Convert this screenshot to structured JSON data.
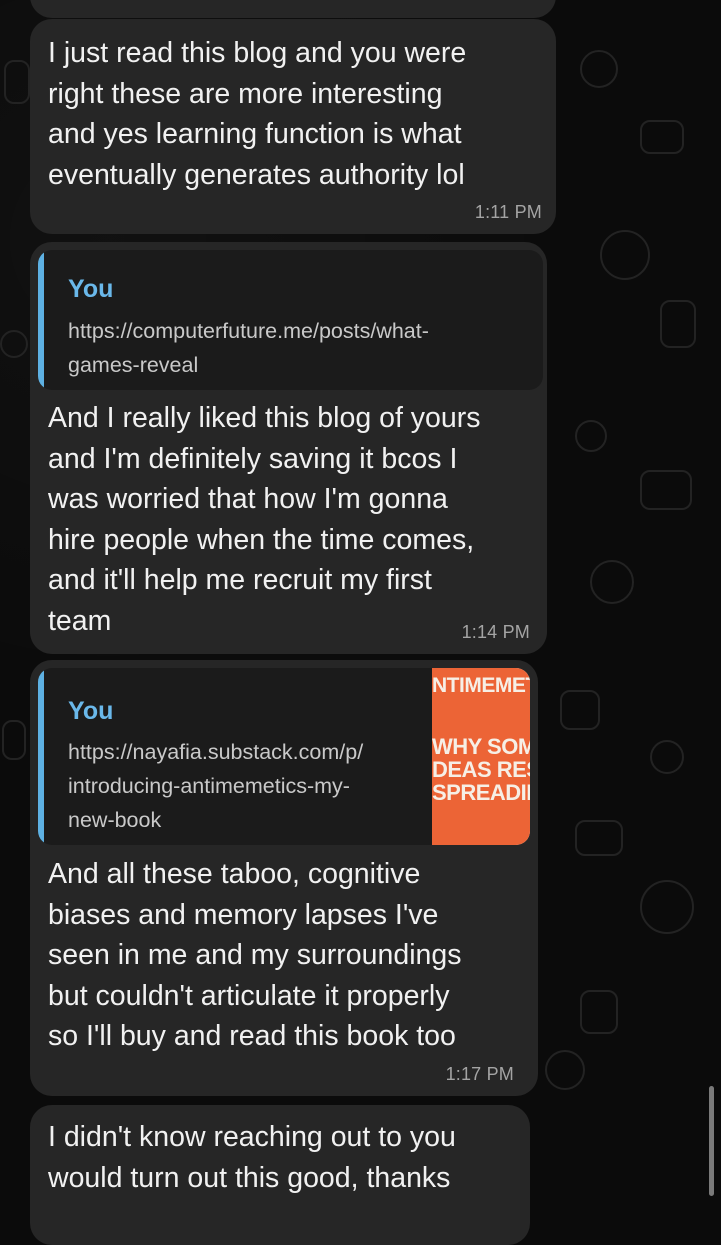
{
  "messages": [
    {
      "text": "I just read this blog and you were\nright these are more interesting\nand yes learning function is what\neventually generates authority lol",
      "time": "1:11 PM"
    },
    {
      "reply": {
        "author": "You",
        "link": "https://computerfuture.me/posts/what-\ngames-reveal"
      },
      "text": "And I really liked this blog of yours\nand I'm definitely saving it bcos I\nwas worried that how I'm gonna\nhire people when the time comes,\nand it'll help me recruit my first\nteam",
      "time": "1:14 PM"
    },
    {
      "reply": {
        "author": "You",
        "link": "https://nayafia.substack.com/p/\nintroducing-antimemetics-my-\nnew-book",
        "thumbnail_lines": [
          "NTIMEMET",
          "WHY SOM",
          "DEAS RES",
          "SPREADIN"
        ]
      },
      "text": "And all these taboo, cognitive\nbiases and memory lapses I've\nseen in me and my surroundings\nbut couldn't articulate it properly\nso I'll buy and read this book too",
      "time": "1:17 PM"
    },
    {
      "text": "I didn't know reaching out to you\nwould turn out this good, thanks"
    }
  ],
  "colors": {
    "background": "#0b0b0b",
    "bubble": "#262626",
    "quote_bar": "#5eb1e3",
    "quote_author": "#6ab8ea",
    "thumbnail": "#ec6436"
  }
}
